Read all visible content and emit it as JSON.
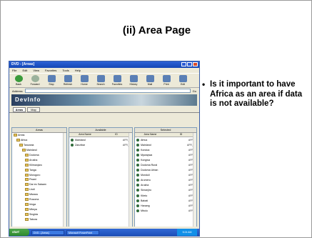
{
  "slide": {
    "title": "(ii) Area Page",
    "bullet": "•",
    "bullet_text": "Is it important to have Africa as an area if data is not available?"
  },
  "window": {
    "title": "DVD - [Areas]",
    "menu": [
      "File",
      "Edit",
      "View",
      "Favorites",
      "Tools",
      "Help"
    ],
    "toolbar": [
      "Back",
      "Forward",
      "Stop",
      "Refresh",
      "Home",
      "Search",
      "Favorites",
      "History",
      "Mail",
      "Print",
      "Edit"
    ],
    "address_label": "Address",
    "go_label": "Go",
    "banner_logo": "DevInfo"
  },
  "tabs": [
    "Areas",
    "Map"
  ],
  "areas_pane": {
    "header": "Areas",
    "tree": [
      "Areas",
      "Africa",
      "Tanzania",
      "Mainland",
      "Dodoma",
      "Arusha",
      "Kilimanjaro",
      "Tanga",
      "Morogoro",
      "Pwani",
      "Dar es Salaam",
      "Lindi",
      "Mtwara",
      "Ruvuma",
      "Iringa",
      "Mbeya",
      "Singida",
      "Tabora"
    ]
  },
  "available_pane": {
    "header": "Available",
    "columns": [
      "Area Name",
      "ID"
    ],
    "rows": [
      {
        "name": "Mainland",
        "id": "AFR_"
      },
      {
        "name": "Zanzibar",
        "id": "AFR_"
      }
    ]
  },
  "selected_pane": {
    "header": "Selected",
    "columns": [
      "Area Name",
      "ID"
    ],
    "rows": [
      {
        "name": "Africa",
        "id": "AFR"
      },
      {
        "name": "Mainland",
        "id": "AFR_"
      },
      {
        "name": "Kondoa",
        "id": "AFR"
      },
      {
        "name": "Mpwapwa",
        "id": "AFR"
      },
      {
        "name": "Kongwa",
        "id": "AFR"
      },
      {
        "name": "Dodoma Rural",
        "id": "AFR"
      },
      {
        "name": "Dodoma Urban",
        "id": "AFR"
      },
      {
        "name": "Monduli",
        "id": "AFR"
      },
      {
        "name": "Arumeru",
        "id": "AFR"
      },
      {
        "name": "Arusha",
        "id": "AFR"
      },
      {
        "name": "Simanjiro",
        "id": "AFR"
      },
      {
        "name": "Kiteto",
        "id": "AFR"
      },
      {
        "name": "Babati",
        "id": "AFR"
      },
      {
        "name": "Hanang",
        "id": "AFR"
      },
      {
        "name": "Mbulu",
        "id": "AFR"
      }
    ]
  },
  "taskbar": {
    "start": "start",
    "tasks": [
      "DVD - [Areas]",
      "Microsoft PowerPoint"
    ],
    "clock": "5:24 AM"
  }
}
